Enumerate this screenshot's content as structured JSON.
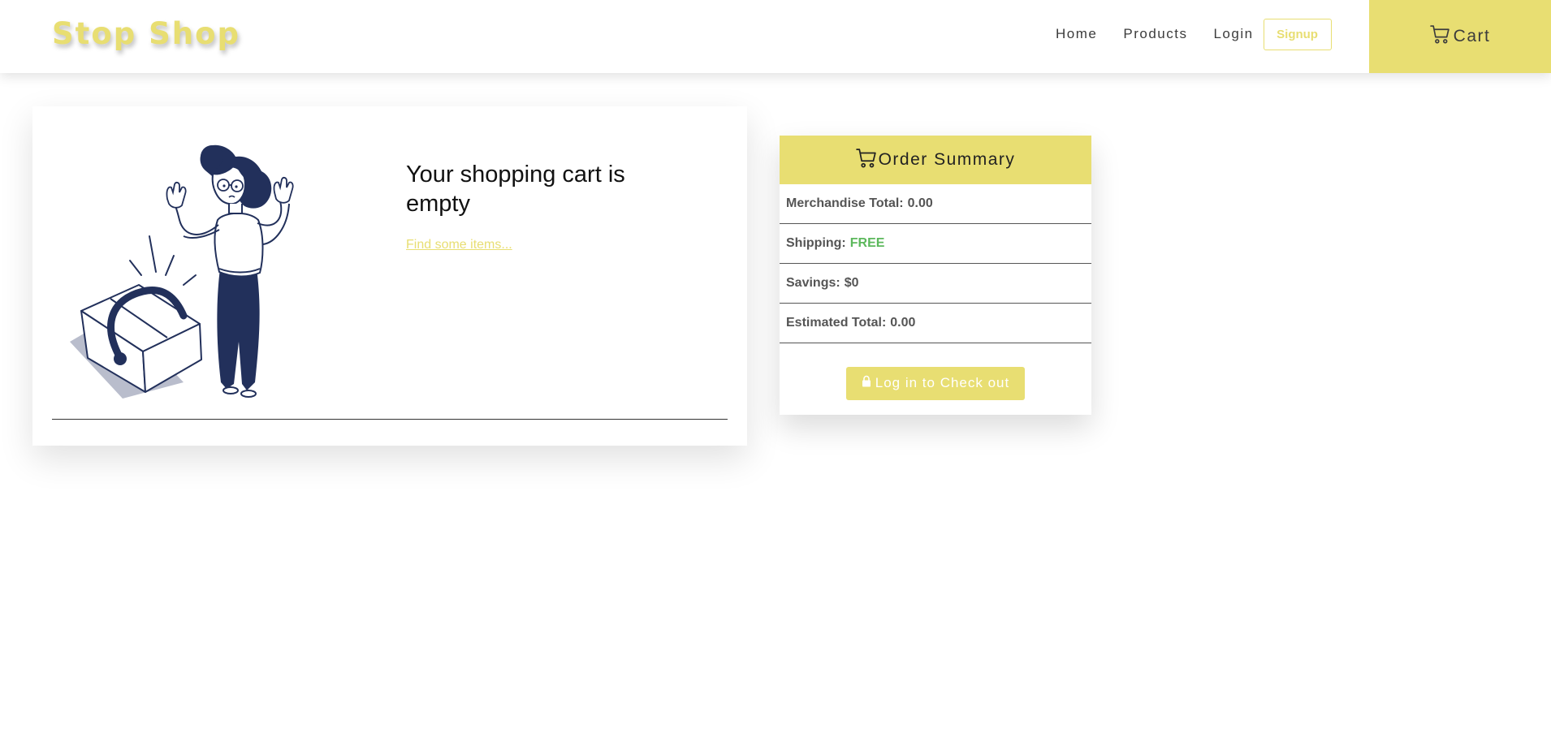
{
  "navbar": {
    "brand": "Stop Shop",
    "links": {
      "home": "Home",
      "products": "Products",
      "login": "Login",
      "signup": "Signup"
    },
    "cart_label": "Cart",
    "cart_icon": "cart-icon"
  },
  "cart": {
    "empty_title": "Your shopping cart is empty",
    "find_link": "Find some items...",
    "illustration": "woman-with-empty-basket"
  },
  "summary": {
    "title": "Order Summary",
    "icon": "cart-icon",
    "merchandise_label": "Merchandise Total:",
    "merchandise_value": "0.00",
    "shipping_label": "Shipping:",
    "shipping_value": "FREE",
    "savings_label": "Savings:",
    "savings_value": "$0",
    "estimated_label": "Estimated Total:",
    "estimated_value": "0.00",
    "checkout_label": "Log in to Check out",
    "checkout_icon": "lock-icon"
  },
  "colors": {
    "accent": "#e8de72",
    "free_green": "#5cb85c",
    "illustration_navy": "#22305b"
  }
}
